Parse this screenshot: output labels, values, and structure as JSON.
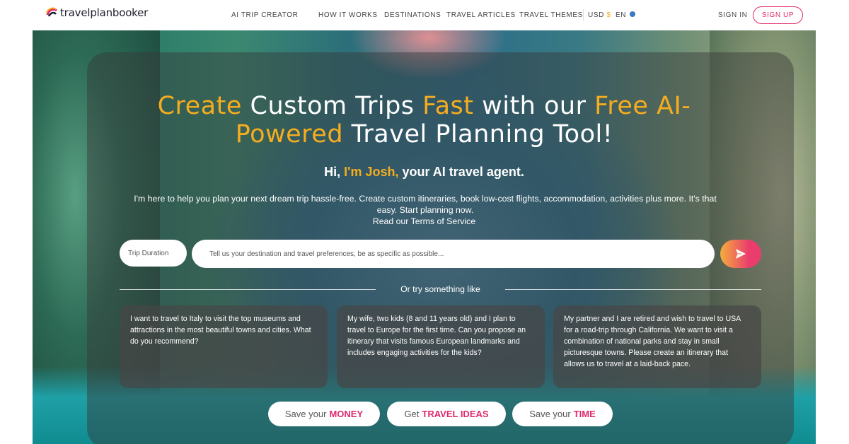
{
  "nav": {
    "logo_text": "travelplanbooker",
    "links": [
      "AI TRIP CREATOR",
      "HOW IT WORKS",
      "DESTINATIONS",
      "TRAVEL ARTICLES",
      "TRAVEL THEMES"
    ],
    "currency": "USD",
    "currency_symbol": "$",
    "language": "EN",
    "sign_in": "SIGN IN",
    "sign_up": "SIGN UP"
  },
  "hero": {
    "headline": {
      "w1": "Create",
      "w2": " Custom Trips ",
      "w3": "Fast",
      "w4": " with our ",
      "w5": "Free AI-",
      "w6": "Powered",
      "w7": " Travel Planning Tool!"
    },
    "greeting": {
      "pre": "Hi, ",
      "name": "I'm Josh,",
      "post": " your AI travel agent."
    },
    "intro": "I'm here to help you plan your next dream trip hassle-free. Create custom itineraries, book low-cost flights, accommodation, activities plus more. It's that easy. Start planning now.",
    "terms": "Read our Terms of Service",
    "duration_placeholder": "Trip Duration",
    "query_placeholder": "Tell us your destination and travel preferences, be as specific as possible...",
    "or_text": "Or try something like",
    "suggestions": [
      "I want to travel to Italy to visit the top museums and attractions in the most beautiful towns and cities. What do you recommend?",
      "My wife, two kids (8 and 11 years old) and I plan to travel to Europe for the first time. Can you propose an itinerary that visits famous European landmarks and includes engaging activities for the kids?",
      "My partner and I are retired and wish to travel to USA for a road-trip through California. We want to visit a combination of national parks and stay in small picturesque towns. Please create an itinerary that allows us to travel at a laid-back pace."
    ],
    "pills": [
      {
        "pre": "Save your",
        "em": "MONEY"
      },
      {
        "pre": "Get",
        "em": "TRAVEL IDEAS"
      },
      {
        "pre": "Save your",
        "em": "TIME"
      }
    ]
  },
  "colors": {
    "accent_pink": "#e0286e",
    "accent_yellow": "#f5ad1f"
  },
  "icons": [
    "logo-mark-icon",
    "globe-icon",
    "send-icon"
  ]
}
